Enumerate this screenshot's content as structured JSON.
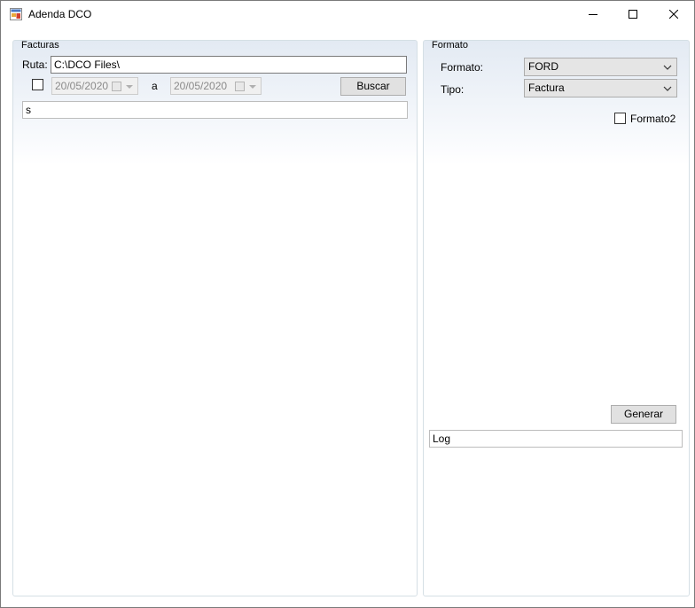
{
  "window": {
    "title": "Adenda DCO",
    "icons": {
      "app": "app-icon",
      "minimize": "minimize-icon",
      "maximize": "maximize-icon",
      "close": "close-icon"
    }
  },
  "facturas": {
    "legend": "Facturas",
    "ruta_label": "Ruta:",
    "ruta_value": "C:\\DCO Files\\",
    "date_filter_checked": false,
    "date_from": "20/05/2020",
    "date_separator": "a",
    "date_to": "20/05/2020",
    "search_button": "Buscar",
    "filter_value": "s"
  },
  "formato": {
    "legend": "Formato",
    "formato_label": "Formato:",
    "formato_value": "FORD",
    "tipo_label": "Tipo:",
    "tipo_value": "Factura",
    "formato2_label": "Formato2",
    "formato2_checked": false,
    "generate_button": "Generar",
    "log_value": "Log"
  }
}
